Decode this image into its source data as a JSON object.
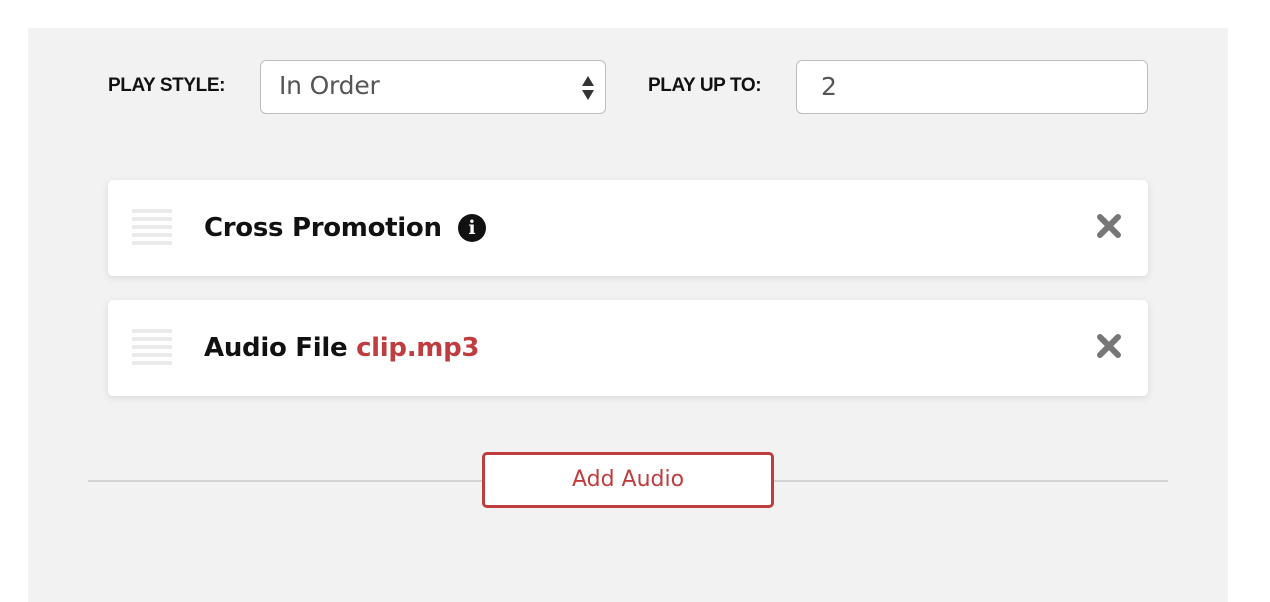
{
  "settings": {
    "play_style_label": "PLAY STYLE:",
    "play_style_value": "In Order",
    "play_up_to_label": "PLAY UP TO:",
    "play_up_to_value": "2"
  },
  "items": [
    {
      "title": "Cross Promotion",
      "filename": "",
      "icons": [
        "drag-handle-icon",
        "info-icon",
        "close-icon"
      ]
    },
    {
      "title": "Audio File",
      "filename": "clip.mp3",
      "icons": [
        "drag-handle-icon",
        "close-icon"
      ]
    }
  ],
  "add_button_label": "Add Audio",
  "colors": {
    "panel_background": "#f2f2f2",
    "accent": "#bf3d3f",
    "text": "#111111",
    "close_icon": "#777777"
  }
}
